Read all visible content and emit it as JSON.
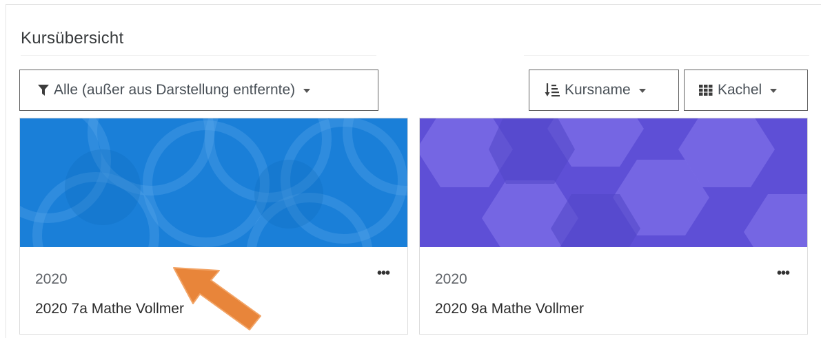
{
  "block": {
    "title": "Kursübersicht"
  },
  "filter": {
    "label": "Alle (außer aus Darstellung entfernte)",
    "icon": "filter-icon"
  },
  "sort": {
    "label": "Kursname",
    "icon": "sort-icon"
  },
  "view": {
    "label": "Kachel",
    "icon": "grid-icon"
  },
  "courses": [
    {
      "category": "2020",
      "name": "2020 7a Mathe Vollmer",
      "menu": "•••",
      "image_color": "#1a7fd8"
    },
    {
      "category": "2020",
      "name": "2020 9a Mathe Vollmer",
      "menu": "•••",
      "image_color": "#6b5ae0"
    }
  ],
  "colors": {
    "arrow": "#e8853a",
    "border": "#dcdcdc"
  }
}
